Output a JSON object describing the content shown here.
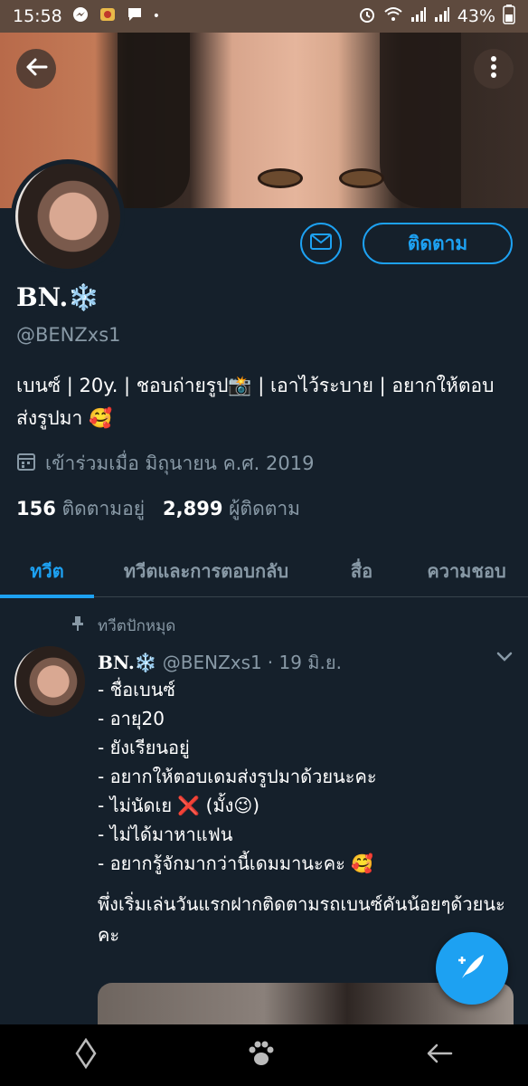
{
  "statusbar": {
    "time": "15:58",
    "battery": "43%"
  },
  "profile": {
    "name": "BN.❄️",
    "handle": "@BENZxs1",
    "bio": "เบนซ์ | 20y. | ชอบถ่ายรูป📸 | เอาไว้ระบาย | อยากให้ตอบส่งรูปมา 🥰",
    "joined": "เข้าร่วมเมื่อ มิถุนายน ค.ศ. 2019",
    "following_count": "156",
    "following_label": "ติดตามอยู่",
    "followers_count": "2,899",
    "followers_label": "ผู้ติดตาม",
    "follow_button": "ติดตาม"
  },
  "tabs": [
    {
      "label": "ทวีต"
    },
    {
      "label": "ทวีตและการตอบกลับ"
    },
    {
      "label": "สื่อ"
    },
    {
      "label": "ความชอบ"
    }
  ],
  "tweet": {
    "pinned_label": "ทวีตปักหมุด",
    "author": "BN.❄️",
    "handle": "@BENZxs1",
    "date": "· 19 มิ.ย.",
    "lines": [
      "- ชื่อเบนซ์",
      "- อายุ20",
      "- ยังเรียนอยู่",
      "- อยากให้ตอบเดมส่งรูปมาด้วยนะคะ",
      "- ไม่นัดเย ❌ (มั้ง😉)",
      "- ไม่ได้มาหาแฟน",
      "- อยากรู้จักมากว่านี้เดมมานะคะ 🥰"
    ],
    "extra": "พึ่งเริ่มเล่นวันแรกฝากติดตามรถเบนซ์คันน้อยๆด้วยนะคะ"
  },
  "colors": {
    "accent": "#1da1f2",
    "background": "#15202b",
    "muted": "#8899a6"
  },
  "icons": [
    "back-arrow-icon",
    "more-vertical-icon",
    "mail-icon",
    "calendar-icon",
    "pin-icon",
    "chevron-down-icon",
    "compose-feather-icon",
    "nav-diamond-icon",
    "nav-paw-icon",
    "nav-back-icon"
  ]
}
